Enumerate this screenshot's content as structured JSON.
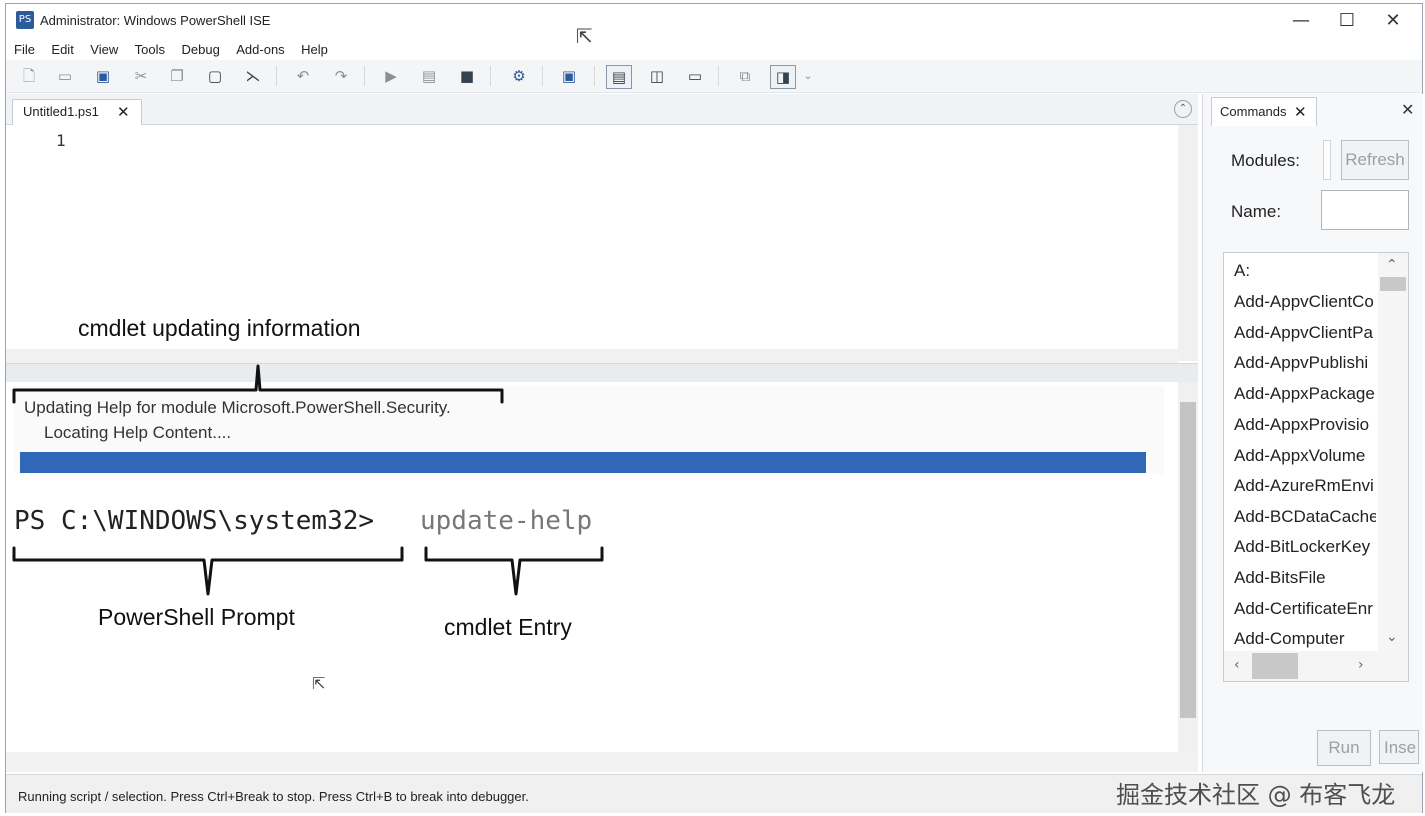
{
  "window": {
    "title": "Administrator: Windows PowerShell ISE",
    "app_icon_glyph": "PS",
    "minimize_glyph": "—",
    "maximize_glyph": "☐",
    "close_glyph": "✕"
  },
  "menu": [
    "File",
    "Edit",
    "View",
    "Tools",
    "Debug",
    "Add-ons",
    "Help"
  ],
  "toolbar": {
    "icons": [
      "new-icon",
      "open-icon",
      "save-icon",
      "cut-icon",
      "copy-icon",
      "paste-icon",
      "clear-icon",
      "undo-icon",
      "redo-icon",
      "run-icon",
      "run-selection-icon",
      "stop-icon",
      "remote-icon",
      "powershell-icon",
      "layout-top-icon",
      "layout-right-icon",
      "layout-max-icon",
      "snippets-icon",
      "commands-pane-icon"
    ],
    "overflow_glyph": "⌄"
  },
  "editor": {
    "tab_label": "Untitled1.ps1",
    "tab_close_glyph": "✕",
    "collapse_glyph": "⌃",
    "line_number": "1"
  },
  "console": {
    "progress_line1": "Updating Help for module Microsoft.PowerShell.Security.",
    "progress_line2": "Locating Help Content....",
    "progress_fraction": 1.0,
    "prompt": "PS C:\\WINDOWS\\system32>",
    "command": "update-help"
  },
  "annotations": {
    "updating_info": "cmdlet updating information",
    "prompt_label": "PowerShell Prompt",
    "entry_label": "cmdlet Entry"
  },
  "status": {
    "text": "Running script / selection.  Press Ctrl+Break to stop.  Press Ctrl+B to break into debugger.",
    "watermark": "掘金技术社区 @ 布客飞龙"
  },
  "commands_pane": {
    "tab_label": "Commands",
    "tab_close_glyph": "✕",
    "pane_close_glyph": "✕",
    "modules_label": "Modules:",
    "refresh_label": "Refresh",
    "name_label": "Name:",
    "items": [
      "A:",
      "Add-AppvClientCo",
      "Add-AppvClientPa",
      "Add-AppvPublishi",
      "Add-AppxPackage",
      "Add-AppxProvisio",
      "Add-AppxVolume",
      "Add-AzureRmEnvi",
      "Add-BCDataCache",
      "Add-BitLockerKey",
      "Add-BitsFile",
      "Add-CertificateEnr",
      "Add-Computer"
    ],
    "run_label": "Run",
    "insert_label": "Inse",
    "scroll_up": "⌃",
    "scroll_down": "⌄",
    "scroll_left": "‹",
    "scroll_right": "›"
  }
}
